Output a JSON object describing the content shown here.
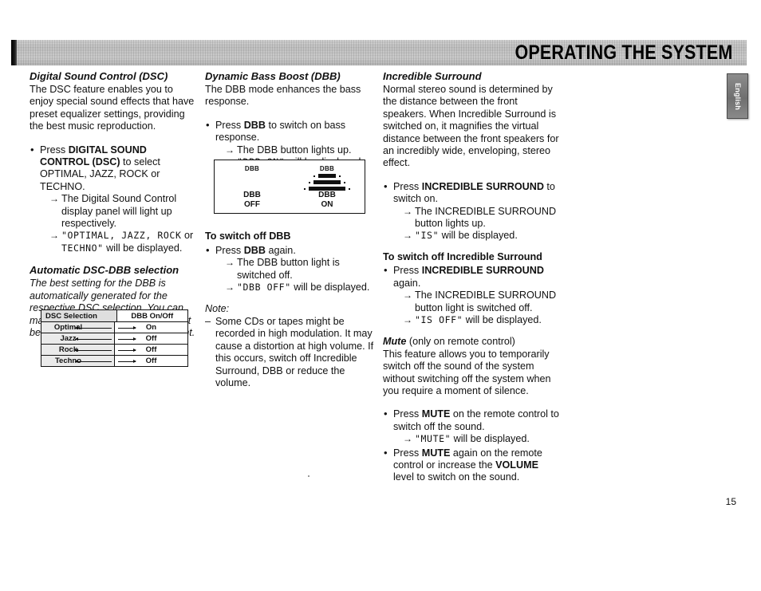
{
  "header": {
    "title": "OPERATING THE SYSTEM",
    "language_tab": "English"
  },
  "page_number": "15",
  "column1": {
    "dsc_heading": "Digital Sound Control  (DSC)",
    "dsc_intro": "The DSC feature enables you to enjoy special sound effects that have preset equalizer settings, providing the best music reproduction.",
    "dsc_bullet_press": "Press ",
    "dsc_bullet_bold1": "DIGITAL SOUND CONTROL (DSC)",
    "dsc_bullet_rest": " to select OPTIMAL, JAZZ, ROCK or TECHNO.",
    "dsc_arrow1": "The Digital Sound Control display panel will light up respectively.",
    "dsc_arrow2_lcd": "\"OPTIMAL, JAZZ, ROCK",
    "dsc_arrow2_tail": " or",
    "dsc_arrow2_lcd2": "TECHNO\"",
    "dsc_arrow2_tail2": " will be displayed.",
    "auto_heading": "Automatic DSC-DBB selection",
    "auto_body": "The best setting for the DBB is automatically generated for the respective DSC selection. You can manually select the DBB setting that best suits your listening environment.",
    "table": {
      "headers": [
        "DSC Selection",
        "DBB On/Off"
      ],
      "rows": [
        {
          "selection": "Optimal",
          "dbb": "On"
        },
        {
          "selection": "Jazz",
          "dbb": "Off"
        },
        {
          "selection": "Rock",
          "dbb": "Off"
        },
        {
          "selection": "Techno",
          "dbb": "Off"
        }
      ]
    }
  },
  "column2": {
    "dbb_heading": "Dynamic Bass Boost  (DBB)",
    "dbb_intro": "The DBB mode enhances the bass response.",
    "dbb_press": "Press ",
    "dbb_press_bold": "DBB",
    "dbb_press_rest": " to switch on bass response.",
    "dbb_arrow1": "The DBB button lights up.",
    "dbb_arrow2_lcd": "\"DBB ON\"",
    "dbb_arrow2_tail": "  will be displayed.",
    "diagram": {
      "left_small": "DBB",
      "left_caption_line1": "DBB",
      "left_caption_line2": "OFF",
      "right_small": "DBB",
      "right_caption_line1": "DBB",
      "right_caption_line2": "ON"
    },
    "switchoff_heading": "To switch off DBB",
    "switchoff_press": "Press ",
    "switchoff_bold": "DBB",
    "switchoff_rest": " again.",
    "switchoff_arrow1": "The DBB button light is switched off.",
    "switchoff_arrow2_lcd": "\"DBB OFF\"",
    "switchoff_arrow2_tail": "  will be displayed.",
    "note_label": "Note:",
    "note_body": "Some CDs or tapes might be recorded in high modulation. It may cause a distortion at high volume. If this occurs, switch off Incredible Surround, DBB or reduce the volume."
  },
  "column3": {
    "is_heading": "Incredible Surround",
    "is_intro": "Normal stereo sound is determined by the distance between the front speakers. When Incredible Surround is switched on, it magnifies the virtual distance between the front speakers for an incredibly wide, enveloping,  stereo effect.",
    "is_press": "Press ",
    "is_press_bold": "INCREDIBLE SURROUND",
    "is_press_rest": " to switch on.",
    "is_arrow1": "The INCREDIBLE SURROUND button lights up.",
    "is_arrow2_lcd": "\"IS\"",
    "is_arrow2_tail": " will be displayed.",
    "is_off_heading": "To switch off Incredible Surround",
    "is_off_press": "Press ",
    "is_off_bold": "INCREDIBLE SURROUND",
    "is_off_rest": " again.",
    "is_off_arrow1": "The INCREDIBLE SURROUND button light is switched off.",
    "is_off_arrow2_lcd": "\"IS OFF\"",
    "is_off_arrow2_tail": "  will be displayed.",
    "mute_heading": "Mute",
    "mute_heading_note": " (only on remote control)",
    "mute_body": "This feature allows you to temporarily switch off the sound of the system without switching off the system when you require a moment of silence.",
    "mute_press": "Press ",
    "mute_press_bold": "MUTE",
    "mute_press_rest": " on the remote control to switch off the sound.",
    "mute_arrow1_lcd": "\"MUTE\"",
    "mute_arrow1_tail": " will be displayed.",
    "mute_press2": "Press ",
    "mute_press2_bold": "MUTE",
    "mute_press2_mid": " again on the remote control or increase the ",
    "mute_press2_bold2": "VOLUME",
    "mute_press2_rest": " level to switch on the sound."
  }
}
